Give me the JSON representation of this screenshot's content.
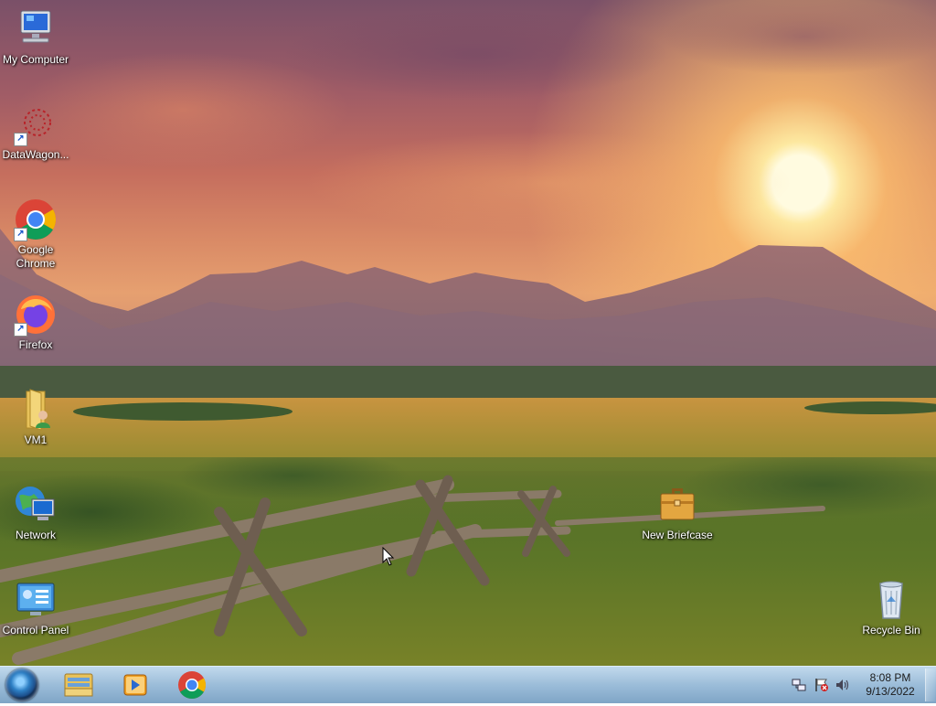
{
  "desktop": {
    "icons": [
      {
        "label": "My Computer",
        "icon": "computer-icon",
        "shortcut": false
      },
      {
        "label": "DataWagon...",
        "icon": "datawagon-icon",
        "shortcut": true
      },
      {
        "label": "Google Chrome",
        "icon": "chrome-icon",
        "shortcut": true
      },
      {
        "label": "Firefox",
        "icon": "firefox-icon",
        "shortcut": true
      },
      {
        "label": "VM1",
        "icon": "user-folder-icon",
        "shortcut": false
      },
      {
        "label": "Network",
        "icon": "network-icon",
        "shortcut": false
      },
      {
        "label": "Control Panel",
        "icon": "control-panel-icon",
        "shortcut": false
      },
      {
        "label": "New Briefcase",
        "icon": "briefcase-icon",
        "shortcut": false
      },
      {
        "label": "Recycle Bin",
        "icon": "recycle-bin-icon",
        "shortcut": false
      }
    ]
  },
  "taskbar": {
    "start": "start-orb-icon",
    "pinned": [
      {
        "icon": "file-explorer-icon"
      },
      {
        "icon": "media-player-icon"
      },
      {
        "icon": "chrome-icon"
      }
    ],
    "tray": {
      "icons": [
        "network-tray-icon",
        "action-center-flag-icon",
        "volume-icon"
      ],
      "time": "8:08 PM",
      "date": "9/13/2022"
    }
  },
  "colors": {
    "taskbar": "#9cbcd8",
    "sun": "#fffbe0",
    "sky": "#c56e5e"
  }
}
